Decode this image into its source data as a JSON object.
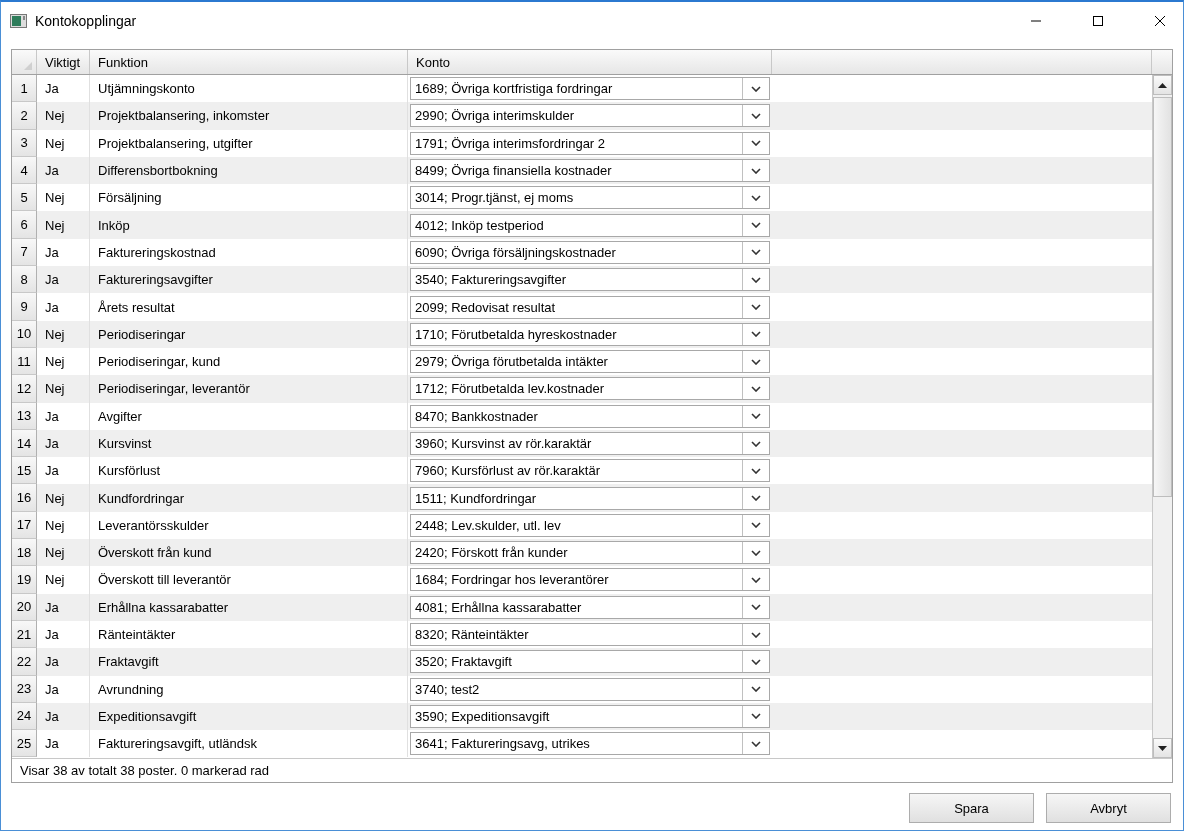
{
  "window": {
    "title": "Kontokopplingar"
  },
  "table": {
    "columns": [
      "Viktigt",
      "Funktion",
      "Konto"
    ],
    "rows": [
      {
        "index": "1",
        "important": "Ja",
        "function": "Utjämningskonto",
        "account": "1689; Övriga kortfristiga fordringar"
      },
      {
        "index": "2",
        "important": "Nej",
        "function": "Projektbalansering, inkomster",
        "account": "2990; Övriga interimskulder"
      },
      {
        "index": "3",
        "important": "Nej",
        "function": "Projektbalansering, utgifter",
        "account": "1791; Övriga interimsfordringar 2"
      },
      {
        "index": "4",
        "important": "Ja",
        "function": "Differensbortbokning",
        "account": "8499; Övriga finansiella kostnader"
      },
      {
        "index": "5",
        "important": "Nej",
        "function": "Försäljning",
        "account": "3014; Progr.tjänst, ej moms"
      },
      {
        "index": "6",
        "important": "Nej",
        "function": "Inköp",
        "account": "4012; Inköp testperiod"
      },
      {
        "index": "7",
        "important": "Ja",
        "function": "Faktureringskostnad",
        "account": "6090; Övriga försäljningskostnader"
      },
      {
        "index": "8",
        "important": "Ja",
        "function": "Faktureringsavgifter",
        "account": "3540; Faktureringsavgifter"
      },
      {
        "index": "9",
        "important": "Ja",
        "function": "Årets resultat",
        "account": "2099; Redovisat resultat"
      },
      {
        "index": "10",
        "important": "Nej",
        "function": "Periodiseringar",
        "account": "1710; Förutbetalda hyreskostnader"
      },
      {
        "index": "11",
        "important": "Nej",
        "function": "Periodiseringar, kund",
        "account": "2979; Övriga förutbetalda intäkter"
      },
      {
        "index": "12",
        "important": "Nej",
        "function": "Periodiseringar, leverantör",
        "account": "1712; Förutbetalda lev.kostnader"
      },
      {
        "index": "13",
        "important": "Ja",
        "function": "Avgifter",
        "account": "8470; Bankkostnader"
      },
      {
        "index": "14",
        "important": "Ja",
        "function": "Kursvinst",
        "account": "3960; Kursvinst av rör.karaktär"
      },
      {
        "index": "15",
        "important": "Ja",
        "function": "Kursförlust",
        "account": "7960; Kursförlust av rör.karaktär"
      },
      {
        "index": "16",
        "important": "Nej",
        "function": "Kundfordringar",
        "account": "1511; Kundfordringar"
      },
      {
        "index": "17",
        "important": "Nej",
        "function": "Leverantörsskulder",
        "account": "2448; Lev.skulder, utl. lev"
      },
      {
        "index": "18",
        "important": "Nej",
        "function": "Överskott från kund",
        "account": "2420; Förskott från kunder"
      },
      {
        "index": "19",
        "important": "Nej",
        "function": "Överskott till leverantör",
        "account": "1684; Fordringar hos leverantörer"
      },
      {
        "index": "20",
        "important": "Ja",
        "function": "Erhållna kassarabatter",
        "account": "4081; Erhållna kassarabatter"
      },
      {
        "index": "21",
        "important": "Ja",
        "function": "Ränteintäkter",
        "account": "8320; Ränteintäkter"
      },
      {
        "index": "22",
        "important": "Ja",
        "function": "Fraktavgift",
        "account": "3520; Fraktavgift"
      },
      {
        "index": "23",
        "important": "Ja",
        "function": "Avrundning",
        "account": "3740; test2"
      },
      {
        "index": "24",
        "important": "Ja",
        "function": "Expeditionsavgift",
        "account": "3590; Expeditionsavgift"
      },
      {
        "index": "25",
        "important": "Ja",
        "function": "Faktureringsavgift, utländsk",
        "account": "3641; Faktureringsavg, utrikes"
      }
    ]
  },
  "status_bar": "Visar 38 av totalt 38 poster. 0 markerad rad",
  "buttons": [
    "Spara",
    "Avbryt"
  ]
}
